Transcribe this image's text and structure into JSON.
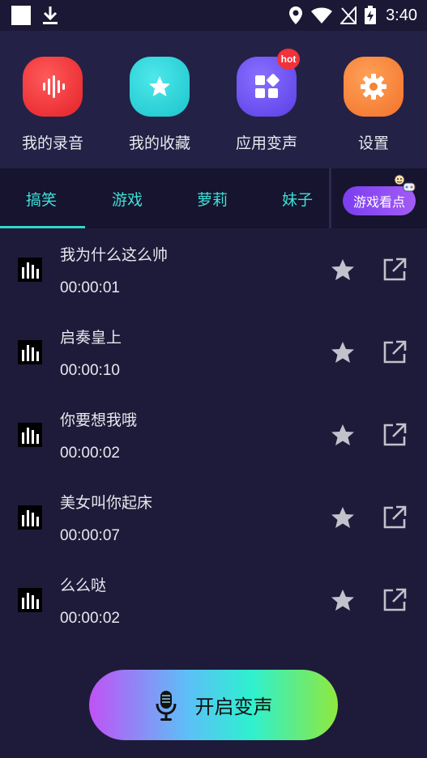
{
  "status_bar": {
    "time": "3:40"
  },
  "shortcuts": [
    {
      "label": "我的录音",
      "icon": "waveform-icon",
      "color": "#f4373c"
    },
    {
      "label": "我的收藏",
      "icon": "star-icon",
      "color": "#27d4d8"
    },
    {
      "label": "应用变声",
      "icon": "apps-icon",
      "color": "#6b4cf0",
      "badge": "hot"
    },
    {
      "label": "设置",
      "icon": "gear-icon",
      "color": "#f7823a"
    }
  ],
  "tabs": [
    {
      "label": "搞笑",
      "active": true
    },
    {
      "label": "游戏"
    },
    {
      "label": "萝莉"
    },
    {
      "label": "妹子"
    }
  ],
  "game_pill": {
    "label": "游戏看点"
  },
  "records": [
    {
      "title": "我为什么这么帅",
      "duration": "00:00:01"
    },
    {
      "title": "启奏皇上",
      "duration": "00:00:10"
    },
    {
      "title": "你要想我哦",
      "duration": "00:00:02"
    },
    {
      "title": "美女叫你起床",
      "duration": "00:00:07"
    },
    {
      "title": "么么哒",
      "duration": "00:00:02"
    }
  ],
  "start_button": {
    "label": "开启变声",
    "icon": "microphone-icon"
  },
  "colors": {
    "accent": "#33d6c7",
    "background": "#1e1b3a",
    "icon_gray": "#c2c2cc"
  }
}
